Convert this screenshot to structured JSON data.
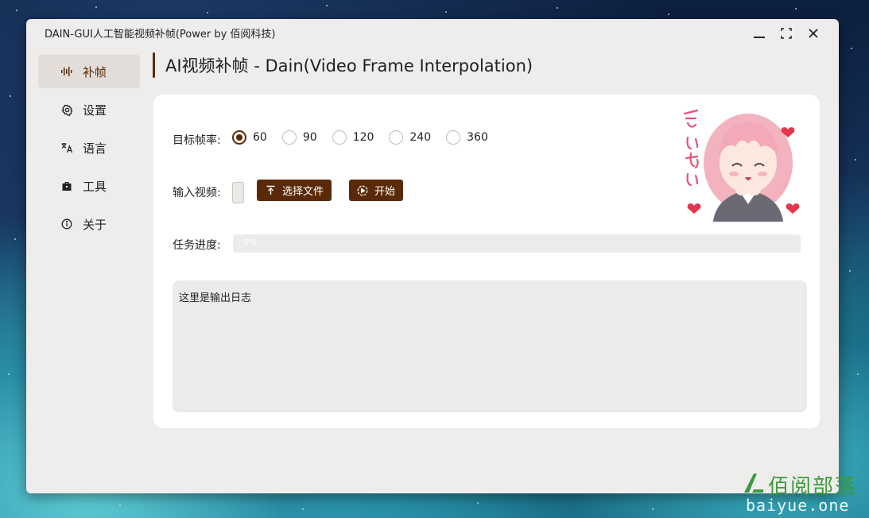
{
  "window": {
    "title": "DAIN-GUI人工智能视频补帧(Power by 佰阅科技)",
    "controls": [
      "minimize-icon",
      "maximize-icon",
      "close-icon"
    ]
  },
  "sidebar": {
    "items": [
      {
        "label": "补帧",
        "icon": "waveform-icon",
        "active": true
      },
      {
        "label": "设置",
        "icon": "gear-icon",
        "active": false
      },
      {
        "label": "语言",
        "icon": "translate-icon",
        "active": false
      },
      {
        "label": "工具",
        "icon": "toolbox-icon",
        "active": false
      },
      {
        "label": "关于",
        "icon": "info-icon",
        "active": false
      }
    ]
  },
  "page": {
    "title": "AI视频补帧 - Dain(Video Frame Interpolation)"
  },
  "framerate": {
    "label": "目标帧率:",
    "options": [
      "60",
      "90",
      "120",
      "240",
      "360"
    ],
    "selected": "60"
  },
  "input_video": {
    "label": "输入视频:",
    "value": "",
    "select_button": "选择文件",
    "start_button": "开始"
  },
  "progress": {
    "label": "任务进度:",
    "value": 0,
    "text": "0%"
  },
  "log": {
    "text": "这里是输出日志"
  },
  "watermark": {
    "cn": "佰阅部落",
    "en": "baiyue.one"
  },
  "colors": {
    "accent": "#5a2a08",
    "window_bg": "#efedec",
    "card_bg": "#ffffff"
  }
}
